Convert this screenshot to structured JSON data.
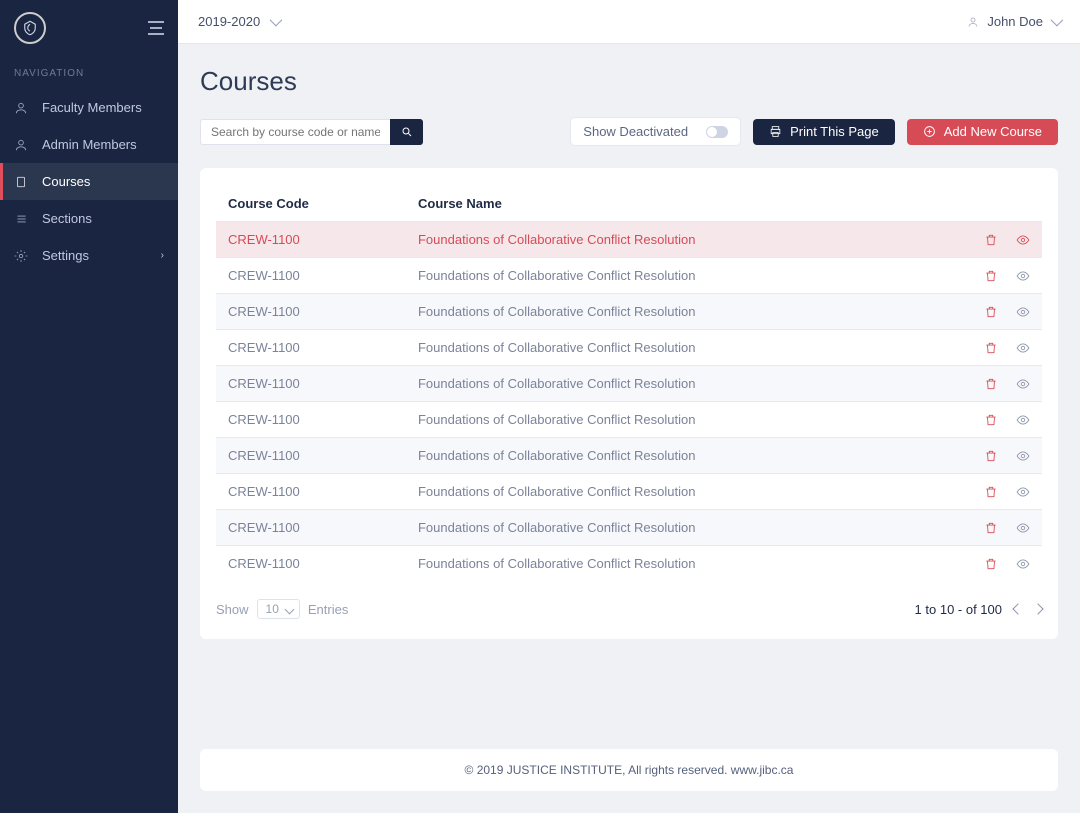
{
  "app": {
    "year_selector": "2019-2020",
    "user_name": "John Doe"
  },
  "nav": {
    "heading": "NAVIGATION",
    "items": [
      {
        "label": "Faculty Members"
      },
      {
        "label": "Admin Members"
      },
      {
        "label": "Courses"
      },
      {
        "label": "Sections"
      },
      {
        "label": "Settings"
      }
    ]
  },
  "page": {
    "title": "Courses",
    "search_placeholder": "Search by course code or name",
    "show_deactivated_label": "Show Deactivated",
    "print_label": "Print This Page",
    "add_label": "Add New Course"
  },
  "table": {
    "col_code": "Course Code",
    "col_name": "Course Name",
    "rows": [
      {
        "code": "CREW-1100",
        "name": "Foundations of Collaborative Conflict Resolution"
      },
      {
        "code": "CREW-1100",
        "name": "Foundations of Collaborative Conflict Resolution"
      },
      {
        "code": "CREW-1100",
        "name": "Foundations of Collaborative Conflict Resolution"
      },
      {
        "code": "CREW-1100",
        "name": "Foundations of Collaborative Conflict Resolution"
      },
      {
        "code": "CREW-1100",
        "name": "Foundations of Collaborative Conflict Resolution"
      },
      {
        "code": "CREW-1100",
        "name": "Foundations of Collaborative Conflict Resolution"
      },
      {
        "code": "CREW-1100",
        "name": "Foundations of Collaborative Conflict Resolution"
      },
      {
        "code": "CREW-1100",
        "name": "Foundations of Collaborative Conflict Resolution"
      },
      {
        "code": "CREW-1100",
        "name": "Foundations of Collaborative Conflict Resolution"
      },
      {
        "code": "CREW-1100",
        "name": "Foundations of Collaborative Conflict Resolution"
      }
    ]
  },
  "pagination": {
    "show_label": "Show",
    "page_size": "10",
    "entries_label": "Entries",
    "range_text": "1 to 10 - of  100"
  },
  "footer": {
    "copyright_prefix": "© 2019 ",
    "institute": "JUSTICE INSTITUTE,",
    "rights": "  All rights reserved. www.jibc.ca"
  }
}
